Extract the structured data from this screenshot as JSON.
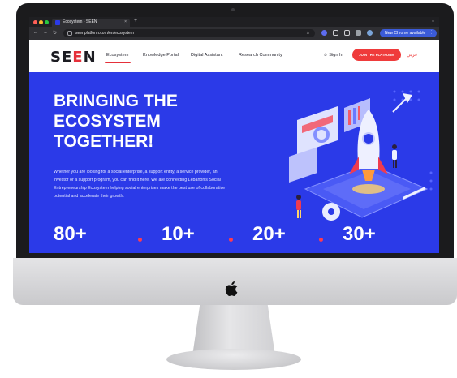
{
  "browser": {
    "tab_title": "Ecosystem - SEEN",
    "tab_close": "×",
    "new_tab": "+",
    "url": "seenplatform.com/en/ecosystem",
    "update_label": "New Chrome available",
    "update_menu": "⋮",
    "window_controls": {
      "close": "#ff5f57",
      "minimize": "#febc2e",
      "maximize": "#28c840"
    }
  },
  "site": {
    "logo": {
      "part1": "SE",
      "accent": "E",
      "part2": "N"
    },
    "nav": [
      {
        "label": "Ecosystem",
        "active": true
      },
      {
        "label": "Knowledge Portal",
        "active": false
      },
      {
        "label": "Digital Assistant",
        "active": false
      },
      {
        "label": "Research Community",
        "active": false
      }
    ],
    "sign_in": "Sign In",
    "join_button": "JOIN THE PLATFORM",
    "language": "عربي",
    "accent_color": "#e5303a",
    "hero_color": "#2b3ae8"
  },
  "hero": {
    "title_lines": [
      "BRINGING THE",
      "ECOSYSTEM",
      "TOGETHER!"
    ],
    "description": "Whether you are looking for a social enterprise, a support entity, a service provider, an investor or a support program, you can find it here. We are connecting Lebanon's Social Entrepreneurship Ecosystem helping social enterprises make the best use of collaborative potential and accelerate their growth.",
    "stats": [
      "80+",
      "10+",
      "20+",
      "30+"
    ]
  }
}
